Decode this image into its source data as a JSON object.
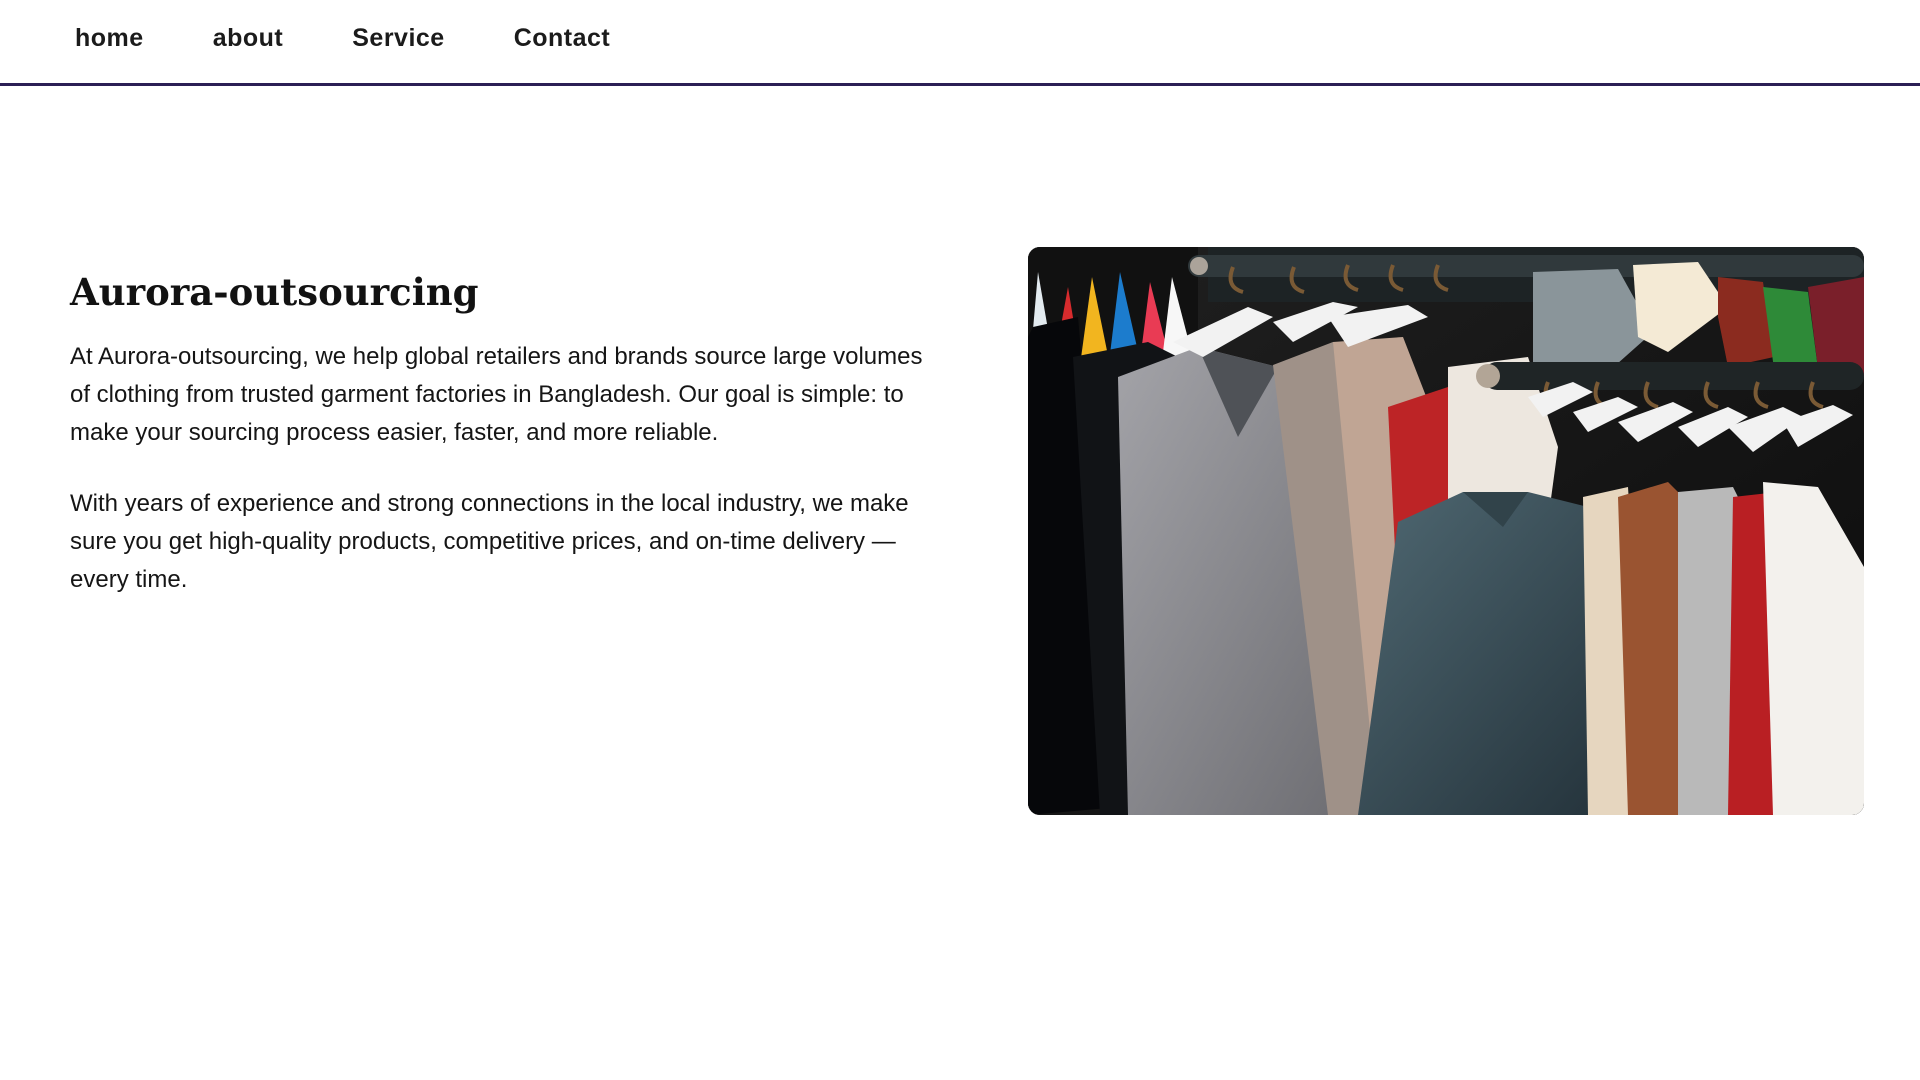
{
  "nav": {
    "items": [
      {
        "label": "home"
      },
      {
        "label": "about"
      },
      {
        "label": "Service"
      },
      {
        "label": "Contact"
      }
    ]
  },
  "intro": {
    "title": "Aurora-outsourcing",
    "paragraphs": [
      "At Aurora-outsourcing, we help global retailers and brands source large volumes of clothing from trusted garment factories in Bangladesh. Our goal is simple: to make your sourcing process easier, faster, and more reliable.",
      "With years of experience and strong connections in the local industry, we make sure you get high-quality products, competitive prices, and on-time delivery — every time."
    ]
  },
  "colors": {
    "nav_border": "#2b1f55",
    "text": "#111111",
    "background": "#ffffff"
  }
}
